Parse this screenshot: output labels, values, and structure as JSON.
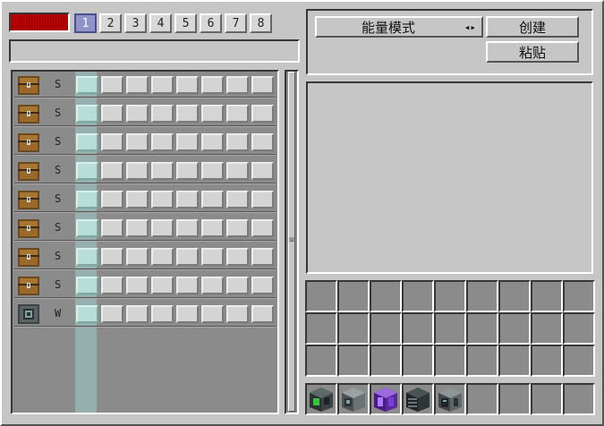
{
  "tabs": [
    "1",
    "2",
    "3",
    "4",
    "5",
    "6",
    "7",
    "8"
  ],
  "active_tab": 0,
  "mode_button": {
    "label": "能量模式",
    "icon": "◂▸"
  },
  "create_button": {
    "label": "创建"
  },
  "paste_button": {
    "label": "粘贴"
  },
  "scroll_grip": "≡",
  "rows": [
    {
      "label": "S",
      "icon": "chest-icon"
    },
    {
      "label": "S",
      "icon": "chest-icon"
    },
    {
      "label": "S",
      "icon": "chest-icon"
    },
    {
      "label": "S",
      "icon": "chest-icon"
    },
    {
      "label": "S",
      "icon": "chest-icon"
    },
    {
      "label": "S",
      "icon": "chest-icon"
    },
    {
      "label": "S",
      "icon": "chest-icon"
    },
    {
      "label": "S",
      "icon": "chest-icon"
    },
    {
      "label": "W",
      "icon": "machine-icon"
    }
  ],
  "hotbar_items": [
    "green-card-block-icon",
    "gray-machine-block-icon",
    "purple-crystal-block-icon",
    "dark-server-block-icon",
    "gray-computer-block-icon"
  ],
  "colors": {
    "energy_bar": "#c00000",
    "active_tab": "#8f93c8",
    "column_highlight": "#a0dcd7"
  }
}
